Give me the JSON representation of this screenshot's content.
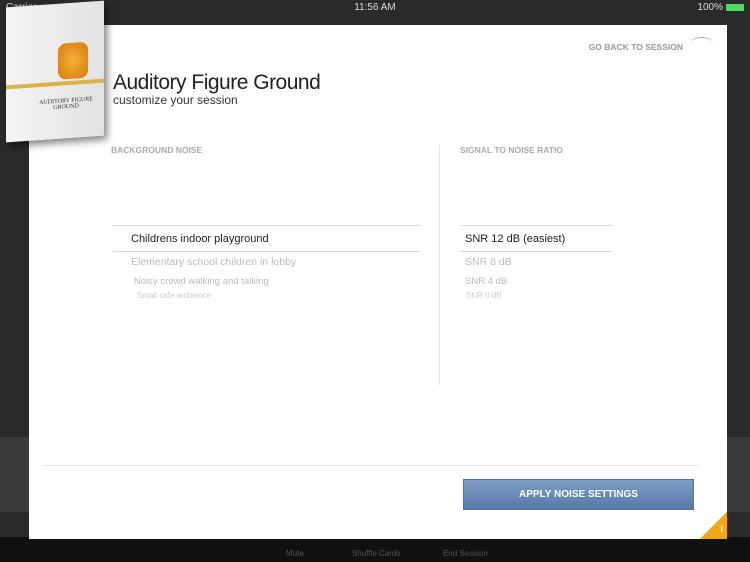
{
  "status_bar": {
    "carrier": "Carrier",
    "time": "11:56 AM",
    "battery": "100%"
  },
  "header": {
    "title": "Auditory Figure Ground",
    "subtitle": "customize your session",
    "back_label": "GO BACK TO SESSION",
    "box_label": "AUDITORY FIGURE GROUND"
  },
  "background_noise": {
    "heading": "BACKGROUND NOISE",
    "selected": "Childrens indoor playground",
    "options": [
      "Elementary school children in lobby",
      "Noisy crowd walking and talking",
      "Small cafe ambience"
    ]
  },
  "snr": {
    "heading": "SIGNAL TO NOISE RATIO",
    "selected": "SNR 12 dB (easiest)",
    "options": [
      "SNR 8 dB",
      "SNR 4 dB",
      "SNR 0 dB"
    ]
  },
  "apply_label": "APPLY NOISE SETTINGS",
  "toolbar": {
    "mute": "Mute",
    "shuffle": "Shuffle Cards",
    "end": "End Session"
  },
  "info_icon": "i"
}
